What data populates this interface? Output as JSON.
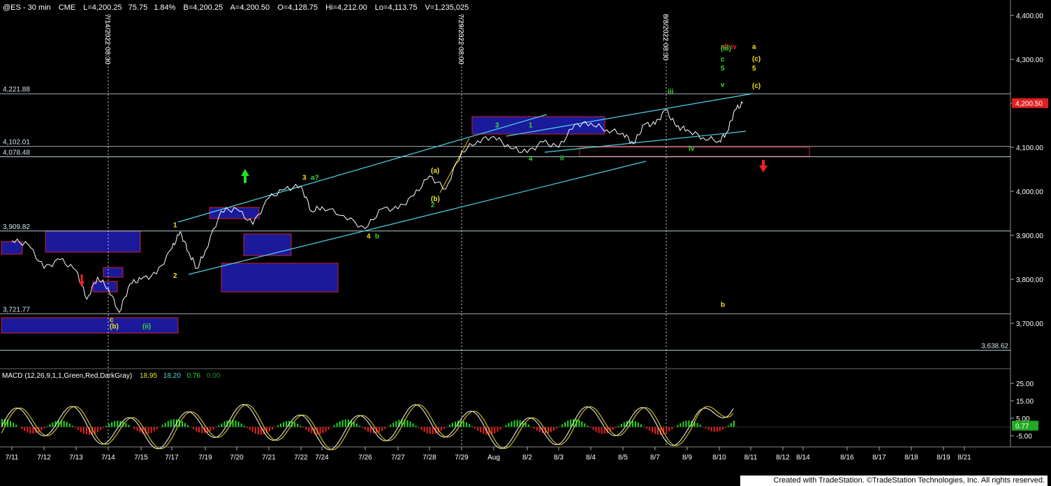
{
  "header": {
    "symbol": "@ES - 30 min",
    "exchange": "CME",
    "last": "L=4,200.25",
    "change": "75.75",
    "change_pct": "1.84%",
    "bid": "B=4,200.25",
    "ask": "A=4,200.50",
    "open": "O=4,128.75",
    "high": "Hi=4,212.00",
    "low": "Lo=4,113.75",
    "volume": "V=1,235,025"
  },
  "macd_header": {
    "label": "MACD (12,26,9,1,1,Green,Red,DarkGray)",
    "macd": "18.95",
    "signal": "18.20",
    "hist": "0.76",
    "zero": "0.00"
  },
  "footer": {
    "text": "Created with TradeStation. ©TradeStation Technologies, Inc. All rights reserved."
  },
  "colors": {
    "background": "#000000",
    "price_line": "#ffffff",
    "channel": "#4dd6ea",
    "box_fill": "#1a1a9a",
    "box_border": "#d0202a",
    "macd_line": "#ffffff",
    "signal_line": "#f0e020",
    "hist_pos": "#22dd22",
    "hist_neg": "#ee2222",
    "label_yellow": "#f0e020",
    "label_green": "#33dd33",
    "label_red": "#ee2222",
    "last_price_bg": "#e02020"
  },
  "chart_data": [
    {
      "type": "line",
      "name": "@ES 30 min price",
      "x_ticks": [
        "7/11",
        "7/12",
        "7/13",
        "7/14",
        "7/15",
        "7/17",
        "7/19",
        "7/20",
        "7/21",
        "7/22",
        "7/24",
        "7/26",
        "7/27",
        "7/28",
        "7/29",
        "Aug",
        "8/2",
        "8/3",
        "8/4",
        "8/5",
        "8/7",
        "8/9",
        "8/10",
        "8/11",
        "8/12",
        "8/14",
        "8/16",
        "8/17",
        "8/18",
        "8/19",
        "8/21"
      ],
      "y_ticks": [
        "4,400.00",
        "4,300.00",
        "4,200.00",
        "4,100.00",
        "4,000.00",
        "3,900.00",
        "3,800.00",
        "3,700.00"
      ],
      "ylim": [
        3610,
        4420
      ],
      "price_path": [
        [
          "7/11",
          3888
        ],
        [
          "7/11",
          3880
        ],
        [
          "7/12",
          3825
        ],
        [
          "7/12",
          3845
        ],
        [
          "7/13",
          3820
        ],
        [
          "7/13",
          3755
        ],
        [
          "7/13",
          3805
        ],
        [
          "7/14",
          3780
        ],
        [
          "7/14",
          3725
        ],
        [
          "7/14",
          3790
        ],
        [
          "7/15",
          3800
        ],
        [
          "7/15",
          3812
        ],
        [
          "7/17",
          3870
        ],
        [
          "7/17",
          3908
        ],
        [
          "7/17",
          3862
        ],
        [
          "7/17",
          3825
        ],
        [
          "7/19",
          3865
        ],
        [
          "7/19",
          3955
        ],
        [
          "7/20",
          3960
        ],
        [
          "7/20",
          3925
        ],
        [
          "7/21",
          3985
        ],
        [
          "7/21",
          4005
        ],
        [
          "7/22",
          4012
        ],
        [
          "7/22",
          3955
        ],
        [
          "7/24",
          3965
        ],
        [
          "7/24",
          3945
        ],
        [
          "7/26",
          3915
        ],
        [
          "7/26",
          3960
        ],
        [
          "7/27",
          3960
        ],
        [
          "7/27",
          3990
        ],
        [
          "7/28",
          4035
        ],
        [
          "7/28",
          4005
        ],
        [
          "7/29",
          4090
        ],
        [
          "7/29",
          4115
        ],
        [
          "Aug",
          4125
        ],
        [
          "Aug",
          4098
        ],
        [
          "8/2",
          4088
        ],
        [
          "8/2",
          4112
        ],
        [
          "8/3",
          4100
        ],
        [
          "8/3",
          4152
        ],
        [
          "8/4",
          4155
        ],
        [
          "8/4",
          4140
        ],
        [
          "8/5",
          4132
        ],
        [
          "8/5",
          4108
        ],
        [
          "8/5",
          4152
        ],
        [
          "8/7",
          4152
        ],
        [
          "8/7",
          4185
        ],
        [
          "8/7",
          4147
        ],
        [
          "8/9",
          4140
        ],
        [
          "8/9",
          4122
        ],
        [
          "8/10",
          4115
        ],
        [
          "8/10",
          4135
        ],
        [
          "8/10",
          4185
        ],
        [
          "8/10",
          4200
        ]
      ],
      "horizontal_levels": [
        {
          "label": "4,221.88",
          "value": 4221.88
        },
        {
          "label": "4,102.01",
          "value": 4102.01
        },
        {
          "label": "4,078.48",
          "value": 4078.48
        },
        {
          "label": "3,909.82",
          "value": 3909.82
        },
        {
          "label": "3,721.77",
          "value": 3721.77
        },
        {
          "label": "3,638.62",
          "value": 3638.62
        }
      ],
      "vertical_markers": [
        {
          "label": "7/14/2022 08:30",
          "x": "7/14"
        },
        {
          "label": "7/29/2022 08:00",
          "x": "7/29"
        },
        {
          "label": "8/8/2022 08:30",
          "x": "8/8"
        }
      ],
      "last_price_label": "4,200.50",
      "wave_labels": [
        {
          "text": "c",
          "x": "7/14",
          "y": 3703,
          "color": "yellow"
        },
        {
          "text": "(b)",
          "x": "7/14",
          "y": 3688,
          "color": "yellow"
        },
        {
          "text": "(ii)",
          "x": "7/15",
          "y": 3688,
          "color": "green"
        },
        {
          "text": "1",
          "x": "7/17",
          "y": 3918,
          "color": "yellow"
        },
        {
          "text": "2",
          "x": "7/17",
          "y": 3803,
          "color": "yellow"
        },
        {
          "text": "3",
          "x": "7/22",
          "y": 4026,
          "color": "yellow"
        },
        {
          "text": "a?",
          "x": "7/22",
          "y": 4026,
          "color": "green"
        },
        {
          "text": "4",
          "x": "7/26",
          "y": 3893,
          "color": "yellow"
        },
        {
          "text": "b",
          "x": "7/26",
          "y": 3893,
          "color": "green"
        },
        {
          "text": "2",
          "x": "7/28",
          "y": 3964,
          "color": "green"
        },
        {
          "text": "(a)",
          "x": "7/28",
          "y": 4042,
          "color": "yellow"
        },
        {
          "text": "(b)",
          "x": "7/28",
          "y": 3978,
          "color": "yellow"
        },
        {
          "text": "3",
          "x": "Aug",
          "y": 4145,
          "color": "green"
        },
        {
          "text": "1",
          "x": "8/2",
          "y": 4145,
          "color": "green"
        },
        {
          "text": "4",
          "x": "8/2",
          "y": 4069,
          "color": "green"
        },
        {
          "text": "ii",
          "x": "8/3",
          "y": 4071,
          "color": "green"
        },
        {
          "text": "iii",
          "x": "8/8",
          "y": 4222,
          "color": "green"
        },
        {
          "text": "iv",
          "x": "8/9",
          "y": 4092,
          "color": "green"
        },
        {
          "text": "alt iv",
          "x": "8/10",
          "y": 4324,
          "color": "red"
        },
        {
          "text": "(iii)",
          "x": "8/10",
          "y": 4320,
          "color": "green"
        },
        {
          "text": "c",
          "x": "8/10",
          "y": 4295,
          "color": "green"
        },
        {
          "text": "5",
          "x": "8/10",
          "y": 4275,
          "color": "green"
        },
        {
          "text": "v",
          "x": "8/10",
          "y": 4237,
          "color": "green"
        },
        {
          "text": "a",
          "x": "8/11",
          "y": 4324,
          "color": "yellow"
        },
        {
          "text": "(c)",
          "x": "8/11",
          "y": 4296,
          "color": "yellow"
        },
        {
          "text": "5",
          "x": "8/11",
          "y": 4275,
          "color": "yellow"
        },
        {
          "text": "(c)",
          "x": "8/11",
          "y": 4235,
          "color": "yellow"
        },
        {
          "text": "b",
          "x": "8/10",
          "y": 3737,
          "color": "yellow"
        }
      ]
    },
    {
      "type": "line",
      "name": "MACD (12,26,9,1,1,Green,Red,DarkGray)",
      "series": [
        {
          "name": "MACD",
          "latest": 18.95
        },
        {
          "name": "Signal",
          "latest": 18.2
        },
        {
          "name": "Hist",
          "latest": 0.76
        }
      ],
      "y_ticks": [
        "25.00",
        "15.00",
        "5.00",
        "-5.00"
      ],
      "last_value_label": "0.77",
      "ylim": [
        -12,
        30
      ]
    }
  ]
}
